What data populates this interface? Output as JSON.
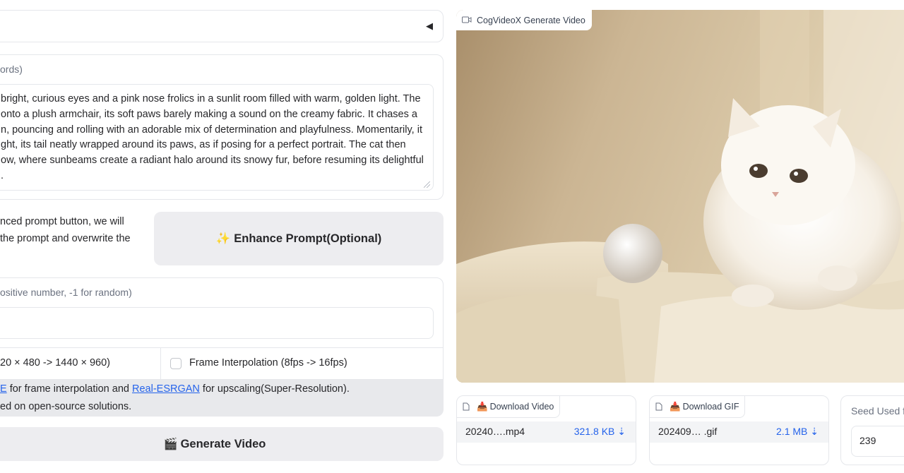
{
  "prompt": {
    "label": "ords)",
    "lines": [
      "bright, curious eyes and a pink nose frolics in a sunlit room filled with warm, golden light. The",
      "onto a plush armchair, its soft paws barely making a sound on the creamy fabric. It chases a",
      "n, pouncing and rolling with an adorable mix of determination and playfulness. Momentarily, it",
      "ght, its tail neatly wrapped around its paws, as if posing for a perfect portrait. The cat then",
      "ow, where sunbeams create a radiant halo around its snowy fur, before resuming its delightful",
      "."
    ]
  },
  "enhance": {
    "note_line1": "nced prompt button, we will",
    "note_line2": "the prompt and overwrite the",
    "button_icon": "sparkles-icon",
    "button_label": "Enhance Prompt(Optional)"
  },
  "seed": {
    "label": "ositive number, -1 for random)",
    "value": ""
  },
  "options": {
    "upscale_label": "20 × 480 -> 1440 × 960)",
    "interpolation_label": "Frame Interpolation (8fps -> 16fps)",
    "interpolation_checked": false
  },
  "info": {
    "link1": "E",
    "text1": " for frame interpolation and ",
    "link2": "Real-ESRGAN",
    "text2": " for upscaling(Super-Resolution).",
    "line2": "ed on open-source solutions."
  },
  "generate": {
    "button_icon": "clapperboard-icon",
    "button_label": "Generate Video"
  },
  "video_panel": {
    "label": "CogVideoX Generate Video",
    "icon": "video-camera-icon"
  },
  "download_video": {
    "label": "Download Video",
    "file_name": "20240….mp4",
    "file_size": "321.8 KB ⇣"
  },
  "download_gif": {
    "label": "Download GIF",
    "file_name": "202409… .gif",
    "file_size": "2.1 MB ⇣"
  },
  "seed_used": {
    "label": "Seed Used f",
    "value": "239"
  },
  "colors": {
    "link": "#2563eb",
    "button_bg": "#ededf0",
    "border": "#e5e7eb",
    "info_bg": "#e8e9ec"
  }
}
